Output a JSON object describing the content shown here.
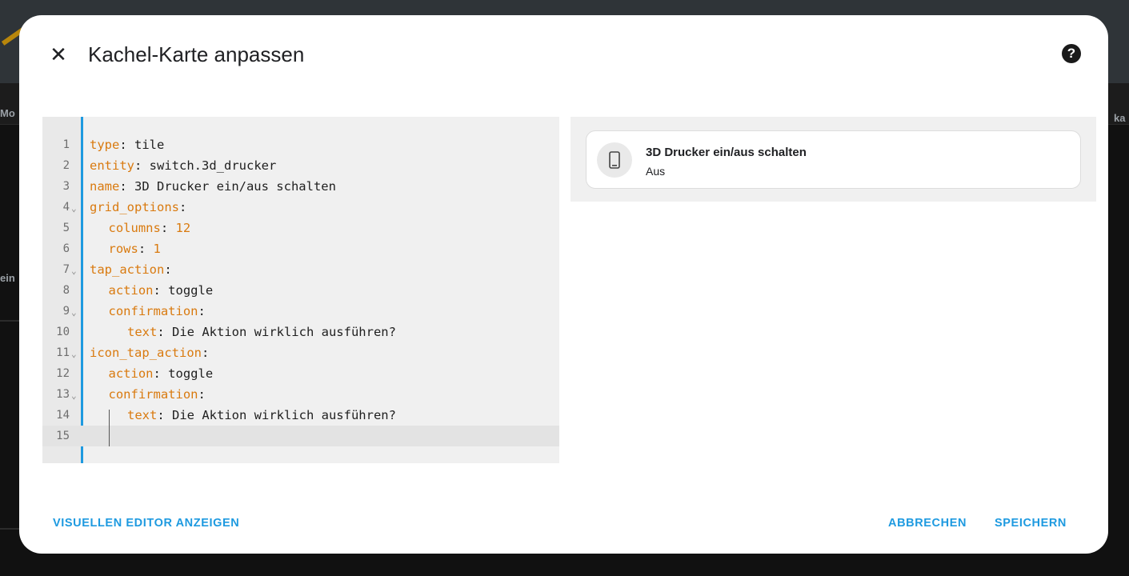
{
  "background": {
    "left_label": "Mo",
    "left_label_2": "ein",
    "right_label": "ka"
  },
  "dialog": {
    "title": "Kachel-Karte anpassen",
    "close_icon": "close-icon",
    "help_icon": "help-circle-icon",
    "help_glyph": "?"
  },
  "editor": {
    "lines": [
      {
        "num": "1",
        "key": "type",
        "value": " tile"
      },
      {
        "num": "2",
        "key": "entity",
        "value": " switch.3d_drucker"
      },
      {
        "num": "3",
        "key": "name",
        "value": " 3D Drucker ein/aus schalten"
      },
      {
        "num": "4",
        "key": "grid_options",
        "value": ""
      },
      {
        "num": "5",
        "key": "columns",
        "value": " 12"
      },
      {
        "num": "6",
        "key": "rows",
        "value": " 1"
      },
      {
        "num": "7",
        "key": "tap_action",
        "value": ""
      },
      {
        "num": "8",
        "key": "action",
        "value": " toggle"
      },
      {
        "num": "9",
        "key": "confirmation",
        "value": ""
      },
      {
        "num": "10",
        "key": "text",
        "value": " Die Aktion wirklich ausführen?"
      },
      {
        "num": "11",
        "key": "icon_tap_action",
        "value": ""
      },
      {
        "num": "12",
        "key": "action",
        "value": " toggle"
      },
      {
        "num": "13",
        "key": "confirmation",
        "value": ""
      },
      {
        "num": "14",
        "key": "text",
        "value": " Die Aktion wirklich ausführen?"
      },
      {
        "num": "15",
        "key": "",
        "value": ""
      }
    ]
  },
  "preview": {
    "tile_name": "3D Drucker ein/aus schalten",
    "tile_state": "Aus",
    "tile_icon": "cellphone-icon"
  },
  "actions": {
    "visual_editor": "VISUELLEN EDITOR ANZEIGEN",
    "cancel": "ABBRECHEN",
    "save": "SPEICHERN"
  },
  "colors": {
    "accent": "#1e9ae0",
    "yaml_key": "#d97a0f"
  }
}
